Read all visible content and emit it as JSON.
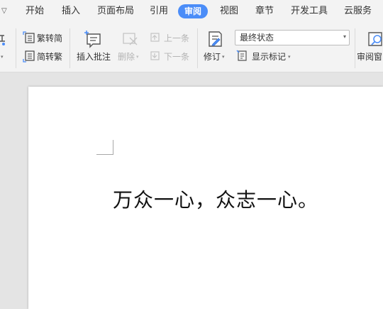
{
  "tabs": [
    {
      "label": "开始",
      "active": false
    },
    {
      "label": "插入",
      "active": false
    },
    {
      "label": "页面布局",
      "active": false
    },
    {
      "label": "引用",
      "active": false
    },
    {
      "label": "审阅",
      "active": true
    },
    {
      "label": "视图",
      "active": false
    },
    {
      "label": "章节",
      "active": false
    },
    {
      "label": "开发工具",
      "active": false
    },
    {
      "label": "云服务",
      "active": false
    }
  ],
  "ribbon": {
    "trad_to_simp": "繁转简",
    "simp_to_trad": "简转繁",
    "insert_comment": "插入批注",
    "delete": "删除",
    "prev_item": "上一条",
    "next_item": "下一条",
    "track_changes": "修订",
    "display_status": "最终状态",
    "show_markup": "显示标记",
    "review_pane": "审阅窗"
  },
  "document": {
    "text": "万众一心，众志一心。"
  },
  "colors": {
    "active_tab": "#4b8df8",
    "ribbon_bg": "#f3f3f3",
    "workspace_bg": "#e4e4e4"
  }
}
